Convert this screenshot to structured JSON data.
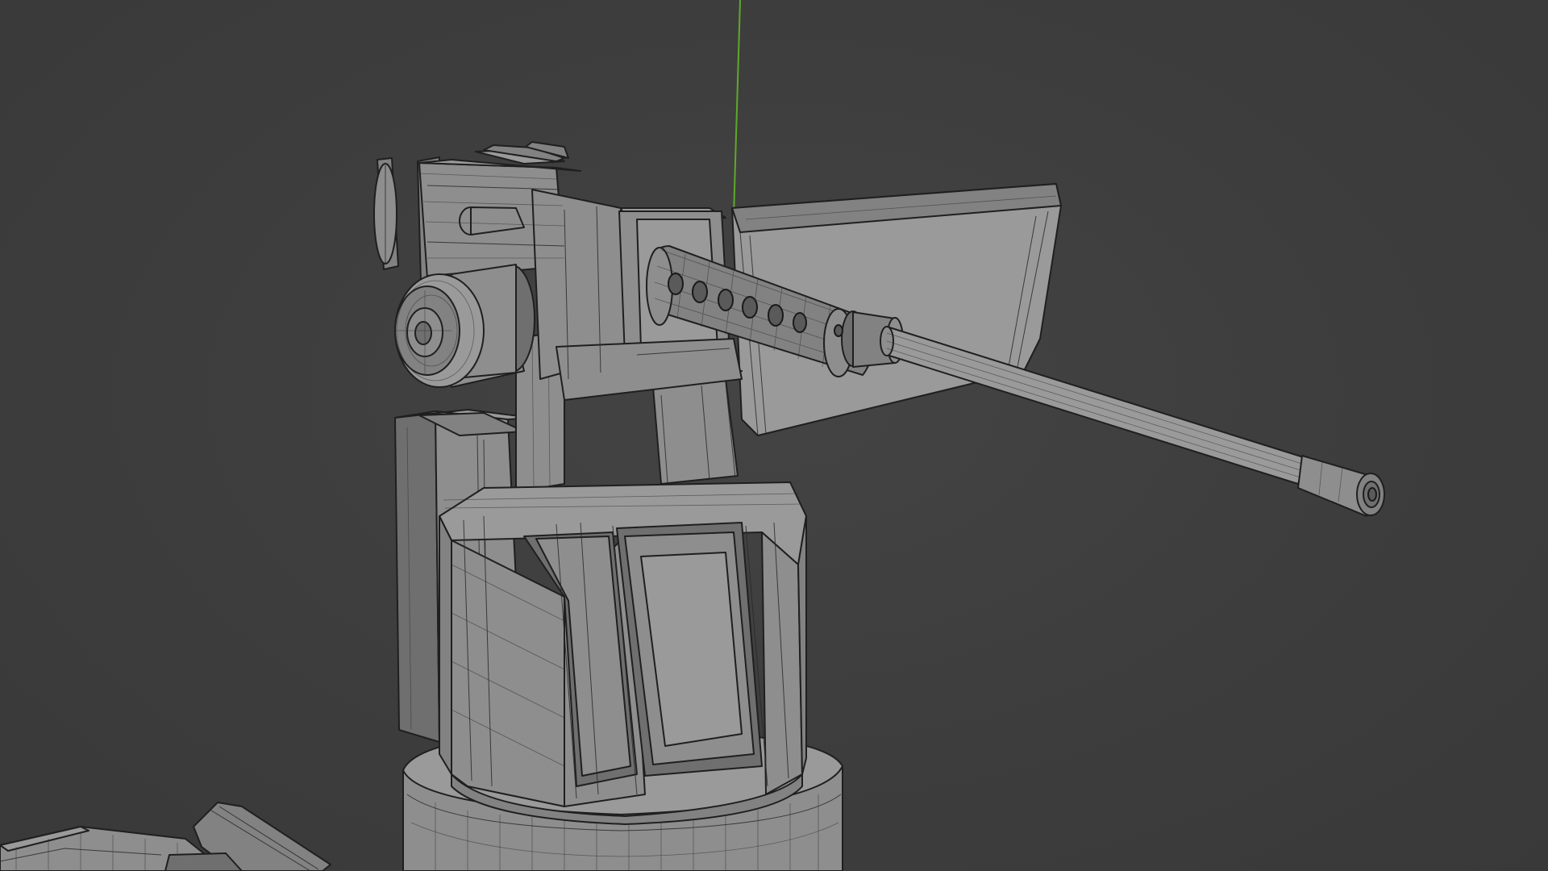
{
  "app": {
    "name": "3D viewport",
    "mode": "wireframe-overlay"
  },
  "viewport": {
    "background_color": "#3d3d3d",
    "mesh_color": "#8e8e8e",
    "wire_color": "#1f1f1f",
    "y_axis_color": "#5fa82a"
  },
  "scene": {
    "objects": [
      {
        "name": "turret-base",
        "icon": "cylinder-shape"
      },
      {
        "name": "turret-housing",
        "icon": "box-shape"
      },
      {
        "name": "ammo-box",
        "icon": "box-shape"
      },
      {
        "name": "machine-gun",
        "icon": "gun-shape"
      },
      {
        "name": "gun-shield",
        "icon": "plate-shape"
      },
      {
        "name": "side-crate",
        "icon": "box-shape"
      }
    ]
  }
}
